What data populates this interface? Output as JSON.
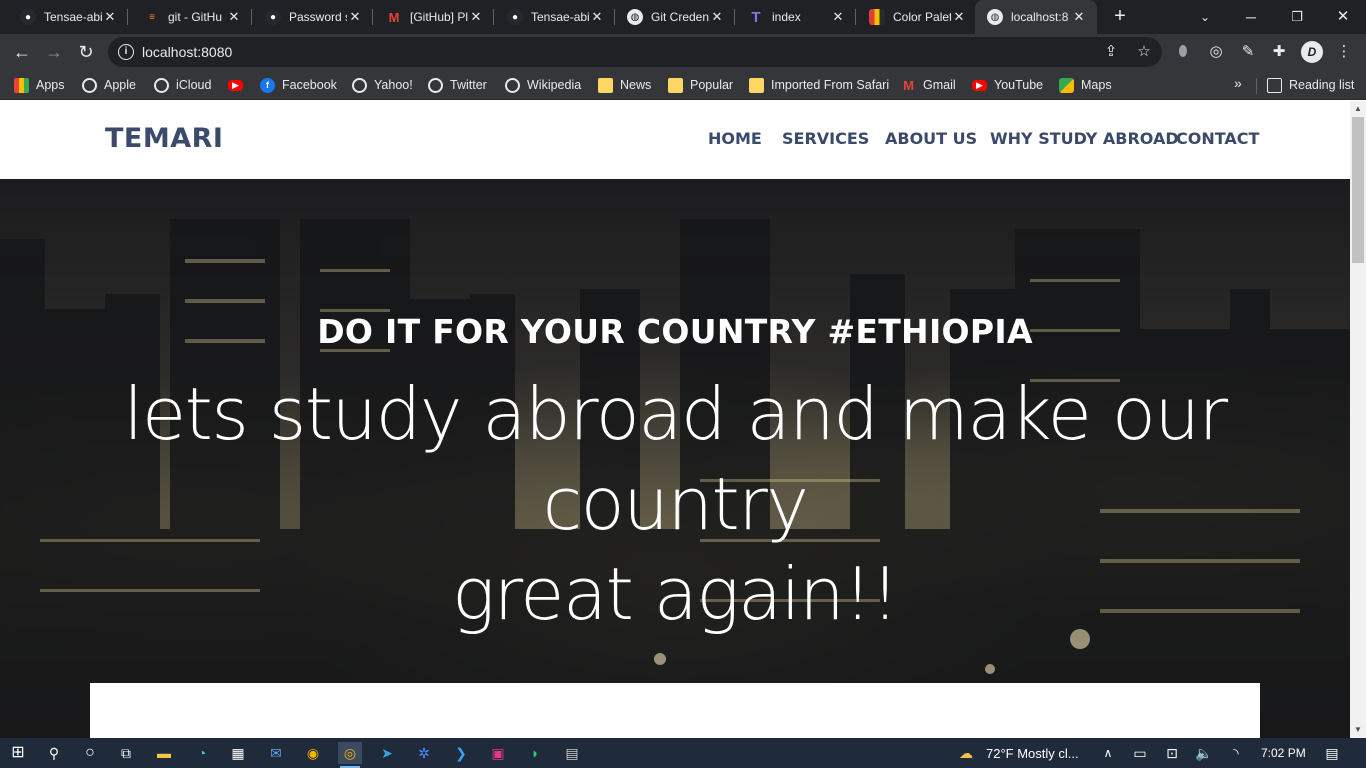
{
  "browser": {
    "tabs": [
      {
        "title": "Tensae-abi",
        "favicon": "github-icon",
        "fav_color": "#24292e"
      },
      {
        "title": "git - GitHu",
        "favicon": "stackoverflow-icon",
        "fav_color": "#f48024"
      },
      {
        "title": "Password s",
        "favicon": "github-icon",
        "fav_color": "#24292e"
      },
      {
        "title": "[GitHub] Pl",
        "favicon": "gmail-icon",
        "fav_color": "#ea4335"
      },
      {
        "title": "Tensae-abi",
        "favicon": "github-icon",
        "fav_color": "#24292e"
      },
      {
        "title": "Git Creden",
        "favicon": "globe-icon",
        "fav_color": "#5f6368"
      },
      {
        "title": "index",
        "favicon": "t-logo-icon",
        "fav_color": "#5b5bd6"
      },
      {
        "title": "Color Palet",
        "favicon": "palette-icon",
        "fav_color": "#e2b400"
      },
      {
        "title": "localhost:8",
        "favicon": "globe-icon",
        "fav_color": "#5f6368",
        "active": true
      }
    ],
    "new_tab_label": "+",
    "url": "localhost:8080"
  },
  "bookmarks": [
    {
      "label": "Apps",
      "icon": "apps-grid-icon"
    },
    {
      "label": "Apple",
      "icon": "globe-icon"
    },
    {
      "label": "iCloud",
      "icon": "globe-icon"
    },
    {
      "label": "",
      "icon": "youtube-icon"
    },
    {
      "label": "Facebook",
      "icon": "facebook-icon"
    },
    {
      "label": "Yahoo!",
      "icon": "globe-icon"
    },
    {
      "label": "Twitter",
      "icon": "globe-icon"
    },
    {
      "label": "Wikipedia",
      "icon": "globe-icon"
    },
    {
      "label": "News",
      "icon": "folder-icon"
    },
    {
      "label": "Popular",
      "icon": "folder-icon"
    },
    {
      "label": "Imported From Safari",
      "icon": "folder-icon"
    },
    {
      "label": "Gmail",
      "icon": "gmail-icon"
    },
    {
      "label": "YouTube",
      "icon": "youtube-icon"
    },
    {
      "label": "Maps",
      "icon": "maps-icon"
    }
  ],
  "bookmarks_more": "»",
  "reading_list": "Reading list",
  "site": {
    "logo": "TEMARI",
    "menu": [
      "HOME",
      "SERVICES",
      "ABOUT US",
      "WHY STUDY ABROAD",
      "CONTACT"
    ],
    "hero_heading": "DO IT FOR YOUR COUNTRY #ETHIOPIA",
    "hero_line1": "lets study abroad and make our country",
    "hero_line2": "great again!!"
  },
  "taskbar": {
    "weather": "72°F  Mostly cl...",
    "time": "7:02 PM"
  },
  "colors": {
    "brand": "#3b4a6b",
    "browser_dark": "#202124",
    "browser_toolbar": "#35363a",
    "taskbar": "#1f2a3a"
  }
}
